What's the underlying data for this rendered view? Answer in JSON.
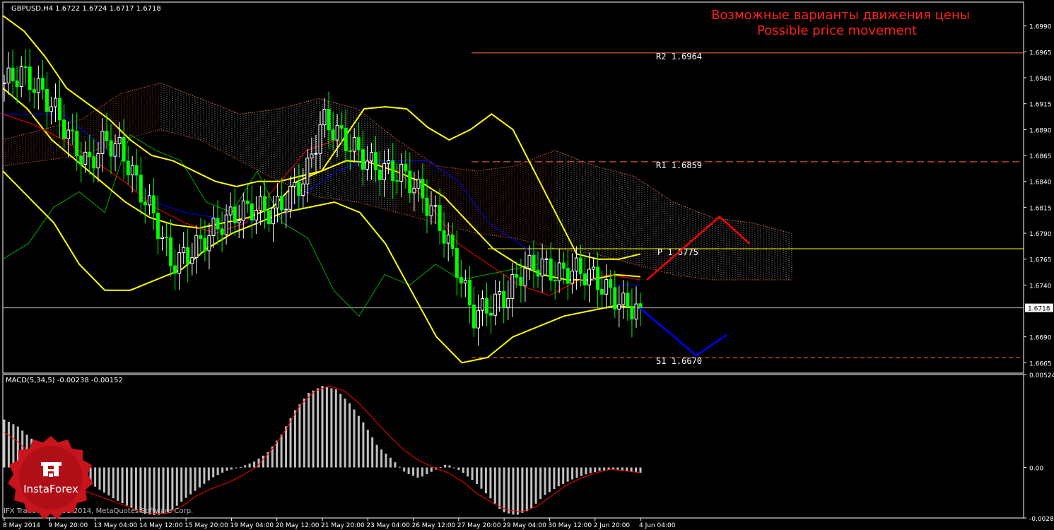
{
  "header": {
    "symbol_info": "GBPUSD,H4 1.6722 1.6724 1.6717 1.6718",
    "title_ru": "Возможные варианты движения цены",
    "title_en": "Possible price movement"
  },
  "colors": {
    "background": "#000000",
    "frame": "#ffffff",
    "grid": "#3a3a3a",
    "bull_candle": "#ffffff",
    "bear_candle": "#00ff00",
    "bollinger": "#ffff00",
    "tenkan": "#0000ff",
    "kijun": "#ff0000",
    "chikou": "#00aa00",
    "kumo_up": "#ffffff",
    "kumo_down": "#ff6a3d",
    "resistance": "#ff6a3d",
    "pivot": "#ffff00",
    "support": "#ff6a3d",
    "forecast_up": "#ff0000",
    "forecast_down": "#0000ff",
    "title_text": "#ff0000",
    "macd_hist": "#c0c0c0",
    "macd_signal": "#ff0000",
    "axis_text": "#ffffff",
    "current_price_tag_bg": "#ffffff",
    "current_price_tag_text": "#000000"
  },
  "chart_data": [
    {
      "type": "candlestick",
      "symbol": "GBPUSD",
      "timeframe": "H4",
      "ylim": [
        1.6655,
        1.7013
      ],
      "yticks": [
        "1.6990",
        "1.6965",
        "1.6940",
        "1.6915",
        "1.6890",
        "1.6865",
        "1.6840",
        "1.6815",
        "1.6790",
        "1.6765",
        "1.6740",
        "1.6690",
        "1.6665"
      ],
      "xticks": [
        "8 May 2014",
        "9 May 20:00",
        "13 May 04:00",
        "14 May 12:00",
        "15 May 20:00",
        "19 May 04:00",
        "20 May 12:00",
        "21 May 20:00",
        "23 May 04:00",
        "26 May 12:00",
        "27 May 20:00",
        "29 May 04:00",
        "30 May 12:00",
        "2 Jun 20:00",
        "4 Jun 04:00"
      ],
      "current_price": "1.6718",
      "last_bar": {
        "open": 1.6722,
        "high": 1.6724,
        "low": 1.6717,
        "close": 1.6718
      },
      "levels": [
        {
          "label": "R2",
          "value": 1.6964,
          "text": "R2 1.6964"
        },
        {
          "label": "R1",
          "value": 1.6859,
          "text": "R1 1.6859"
        },
        {
          "label": "P",
          "value": 1.6775,
          "text": "P 1.6775"
        },
        {
          "label": "S1",
          "value": 1.667,
          "text": "S1 1.6670"
        }
      ],
      "forecast_up": [
        1.6745,
        1.6806,
        1.678
      ],
      "forecast_down": [
        1.6718,
        1.6672,
        1.6692
      ],
      "close_path": [
        1.6935,
        1.6945,
        1.693,
        1.691,
        1.688,
        1.6855,
        1.688,
        1.687,
        1.6835,
        1.6805,
        1.676,
        1.677,
        1.6785,
        1.68,
        1.681,
        1.6815,
        1.681,
        1.6825,
        1.6845,
        1.69,
        1.6885,
        1.687,
        1.6855,
        1.685,
        1.6845,
        1.6825,
        1.68,
        1.676,
        1.671,
        1.672,
        1.673,
        1.6755,
        1.676,
        1.675,
        1.6755,
        1.675,
        1.6735,
        1.672,
        1.6718
      ],
      "bb_upper": [
        1.7,
        1.6985,
        1.696,
        1.693,
        1.6915,
        1.69,
        1.688,
        1.6865,
        1.686,
        1.685,
        1.684,
        1.6835,
        1.684,
        1.684,
        1.6845,
        1.685,
        1.688,
        1.691,
        1.6912,
        1.691,
        1.6892,
        1.688,
        1.689,
        1.6905,
        1.689,
        1.685,
        1.681,
        1.677,
        1.6765,
        1.6765,
        1.677
      ],
      "bb_middle": [
        1.693,
        1.691,
        1.688,
        1.686,
        1.684,
        1.682,
        1.6805,
        1.6798,
        1.6795,
        1.68,
        1.6805,
        1.6815,
        1.684,
        1.685,
        1.686,
        1.6858,
        1.685,
        1.684,
        1.6825,
        1.68,
        1.6775,
        1.676,
        1.675,
        1.6745,
        1.6745,
        1.675,
        1.6748
      ],
      "bb_lower": [
        1.685,
        1.6825,
        1.68,
        1.676,
        1.6735,
        1.6735,
        1.6745,
        1.6755,
        1.6775,
        1.679,
        1.68,
        1.681,
        1.6815,
        1.682,
        1.681,
        1.678,
        1.6735,
        1.669,
        1.6665,
        1.667,
        1.669,
        1.67,
        1.671,
        1.6715,
        1.672,
        1.6718
      ],
      "tenkan": [
        1.6905,
        1.6905,
        1.6905,
        1.688,
        1.686,
        1.682,
        1.681,
        1.6805,
        1.68,
        1.68,
        1.683,
        1.685,
        1.686,
        1.686,
        1.686,
        1.684,
        1.68,
        1.678,
        1.676,
        1.675,
        1.674,
        1.674
      ],
      "kijun": [
        1.6905,
        1.6895,
        1.688,
        1.686,
        1.684,
        1.6815,
        1.68,
        1.679,
        1.68,
        1.6835,
        1.687,
        1.688,
        1.686,
        1.685,
        1.682,
        1.678,
        1.676,
        1.674,
        1.673,
        1.6745,
        1.675,
        1.6745
      ],
      "chikou": [
        1.6765,
        1.678,
        1.6815,
        1.683,
        1.681,
        1.6885,
        1.687,
        1.686,
        1.682,
        1.681,
        1.685,
        1.68,
        1.6785,
        1.6735,
        1.671,
        1.675,
        1.674,
        1.676,
        1.6745,
        1.675,
        1.6755,
        1.676
      ],
      "kumo_top": [
        1.688,
        1.689,
        1.69,
        1.6925,
        1.6935,
        1.692,
        1.6905,
        1.691,
        1.692,
        1.691,
        1.688,
        1.6855,
        1.685,
        1.6855,
        1.687,
        1.6855,
        1.6845,
        1.682,
        1.6805,
        1.68,
        1.679
      ],
      "kumo_bottom": [
        1.6855,
        1.686,
        1.6865,
        1.688,
        1.689,
        1.688,
        1.686,
        1.684,
        1.6825,
        1.682,
        1.681,
        1.68,
        1.679,
        1.6785,
        1.6775,
        1.677,
        1.676,
        1.675,
        1.6745,
        1.6745,
        1.6745
      ],
      "kumo_up": [
        0,
        0,
        0,
        0,
        1,
        1,
        1,
        1,
        1,
        1,
        0,
        0,
        0,
        0,
        1,
        1,
        1,
        1,
        1,
        1,
        1
      ]
    },
    {
      "type": "bar",
      "name": "MACD(5,34,5)",
      "label": "MACD(5,34,5) -0.00238 -0.00152",
      "ylim": [
        -0.00285,
        0.00524
      ],
      "yticks": [
        "0.00524",
        "0.00",
        "-0.00285"
      ],
      "histogram": [
        0.0027,
        0.0023,
        0.0016,
        0.0008,
        0.0,
        -0.0005,
        -0.0008,
        -0.0013,
        -0.0018,
        -0.0022,
        -0.0026,
        -0.0027,
        -0.0025,
        -0.0018,
        -0.0012,
        -0.0006,
        -0.0002,
        0.0,
        0.0003,
        0.0008,
        0.0018,
        0.0032,
        0.0042,
        0.0046,
        0.0044,
        0.0036,
        0.0025,
        0.0012,
        0.0005,
        -0.0003,
        -0.0006,
        -0.0002,
        0.0002,
        -0.0002,
        -0.0008,
        -0.0016,
        -0.0025,
        -0.0027,
        -0.0024,
        -0.0016,
        -0.0011,
        -0.0007,
        -0.0004,
        -0.0002,
        -0.0001,
        -0.0002,
        -0.0003
      ],
      "signal": [
        0.002,
        0.0014,
        0.0006,
        -0.0001,
        -0.0008,
        -0.0012,
        -0.0015,
        -0.0018,
        -0.0021,
        -0.0024,
        -0.0026,
        -0.0026,
        -0.0022,
        -0.0016,
        -0.0012,
        -0.0009,
        -0.0005,
        0.0,
        0.0009,
        0.0021,
        0.0035,
        0.0043,
        0.0046,
        0.0043,
        0.0036,
        0.0027,
        0.0018,
        0.001,
        0.0004,
        0.0,
        -0.0003,
        -0.0008,
        -0.0015,
        -0.002,
        -0.0024,
        -0.0025,
        -0.0022,
        -0.0016,
        -0.001,
        -0.0006,
        -0.0003,
        -0.0001,
        -0.0002,
        -0.0003
      ],
      "hist_color": "#c0c0c0",
      "signal_color": "#ff0000"
    }
  ],
  "watermark": {
    "copyright": "IFX Trader, © 2001-2014, MetaQuotes Software Corp.",
    "logo_text": "InstaForex"
  }
}
